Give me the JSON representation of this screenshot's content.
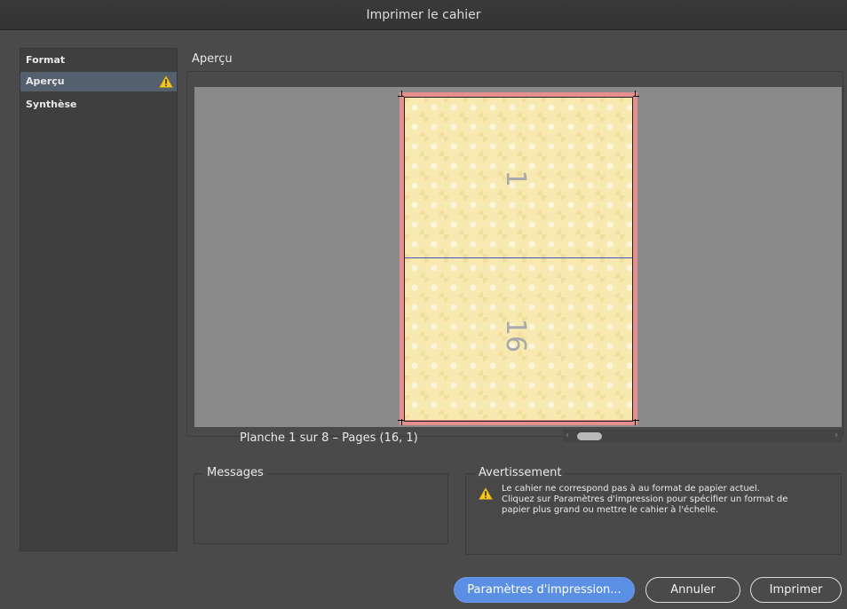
{
  "window": {
    "title": "Imprimer le cahier"
  },
  "sidebar": {
    "items": [
      {
        "label": "Format",
        "selected": false,
        "warning": false
      },
      {
        "label": "Aperçu",
        "selected": true,
        "warning": true
      },
      {
        "label": "Synthèse",
        "selected": false,
        "warning": false
      }
    ]
  },
  "preview": {
    "title": "Aperçu",
    "pages": [
      "1",
      "16"
    ],
    "spread_label": "Planche 1 sur 8 – Pages (16, 1)"
  },
  "messages": {
    "title": "Messages"
  },
  "warning": {
    "title": "Avertissement",
    "lines": [
      "Le cahier ne correspond pas à au format de papier actuel.",
      "Cliquez sur Paramètres d'impression pour spécifier un format de",
      "papier plus grand ou mettre le cahier à l'échelle."
    ]
  },
  "buttons": {
    "print_settings": "Paramètres d'impression...",
    "cancel": "Annuler",
    "print": "Imprimer"
  },
  "colors": {
    "accent": "#5b8fe3",
    "selection": "#55606f",
    "warning": "#f2c522",
    "sheet_bleed": "#e78f8f"
  },
  "icons": {
    "warning": "warning-triangle-icon",
    "scroll_left": "chevron-left-icon",
    "scroll_right": "chevron-right-icon"
  }
}
